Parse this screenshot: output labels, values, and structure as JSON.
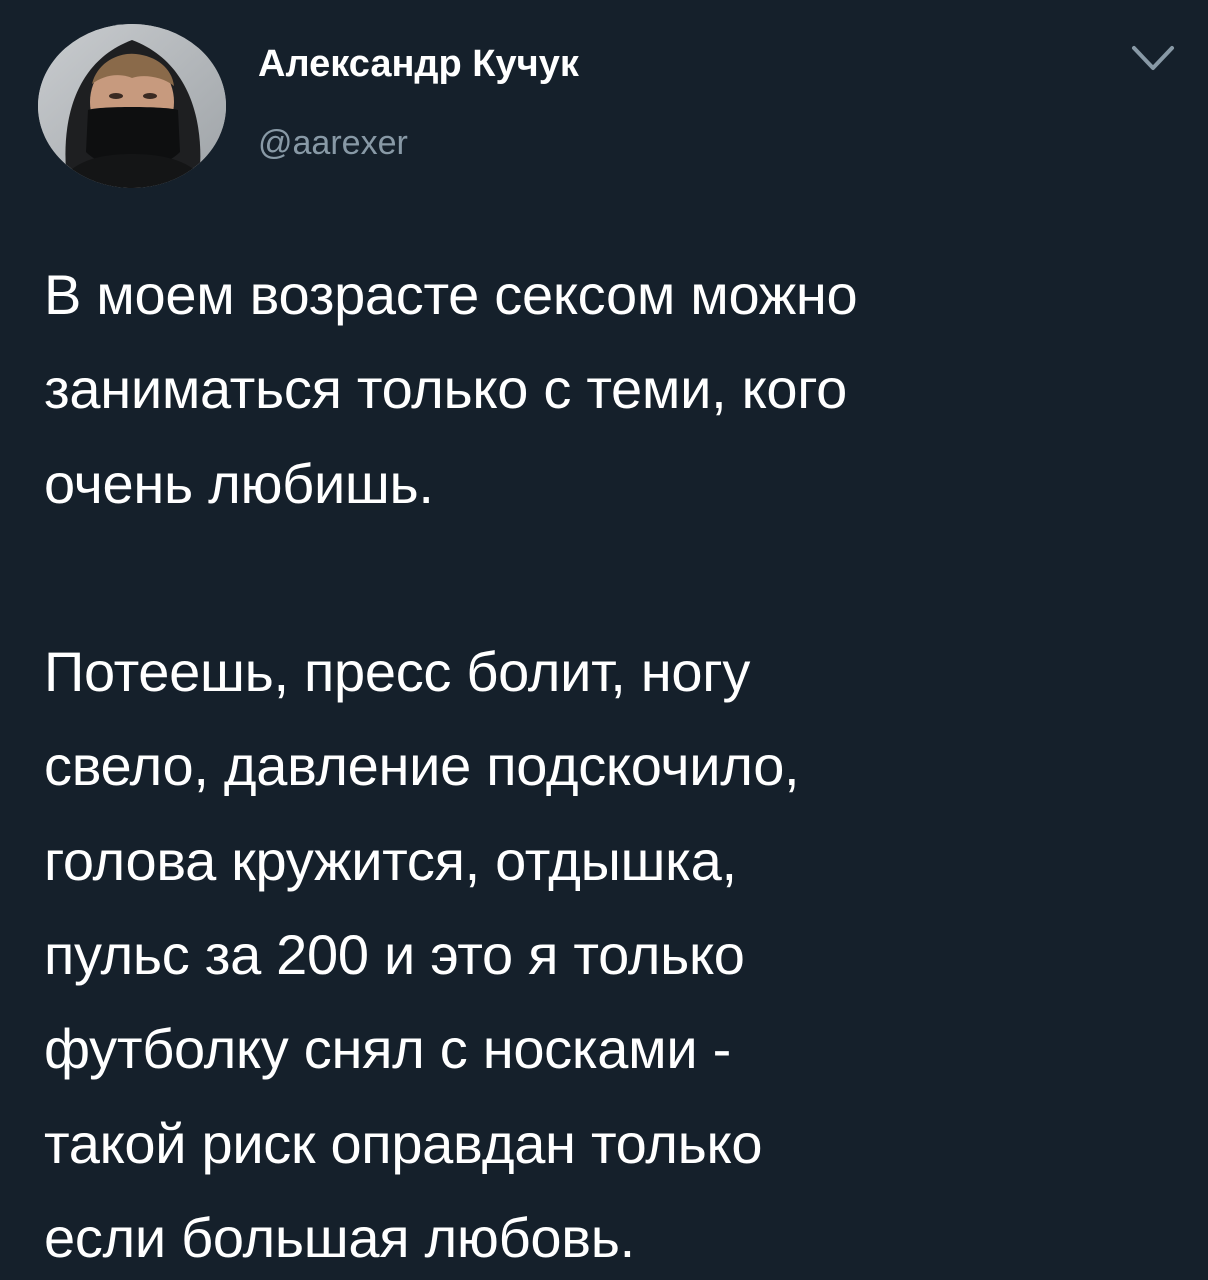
{
  "author": {
    "display_name": "Александр Кучук",
    "handle": "@aarexer",
    "avatar_icon": "profile-photo-hooded-masked"
  },
  "menu": {
    "icon": "chevron-down-icon"
  },
  "tweet": {
    "lines": [
      "В моем возрасте сексом можно",
      "заниматься только с теми, кого",
      "очень любишь.",
      "",
      "Потеешь, пресс болит, ногу",
      "свело, давление подскочило,",
      "голова кружится, отдышка,",
      "пульс за 200 и это я только",
      "футболку снял с носками -",
      "такой риск оправдан только",
      "если большая любовь."
    ]
  },
  "colors": {
    "background": "#15202b",
    "text_primary": "#ffffff",
    "text_secondary": "#8899a6"
  }
}
